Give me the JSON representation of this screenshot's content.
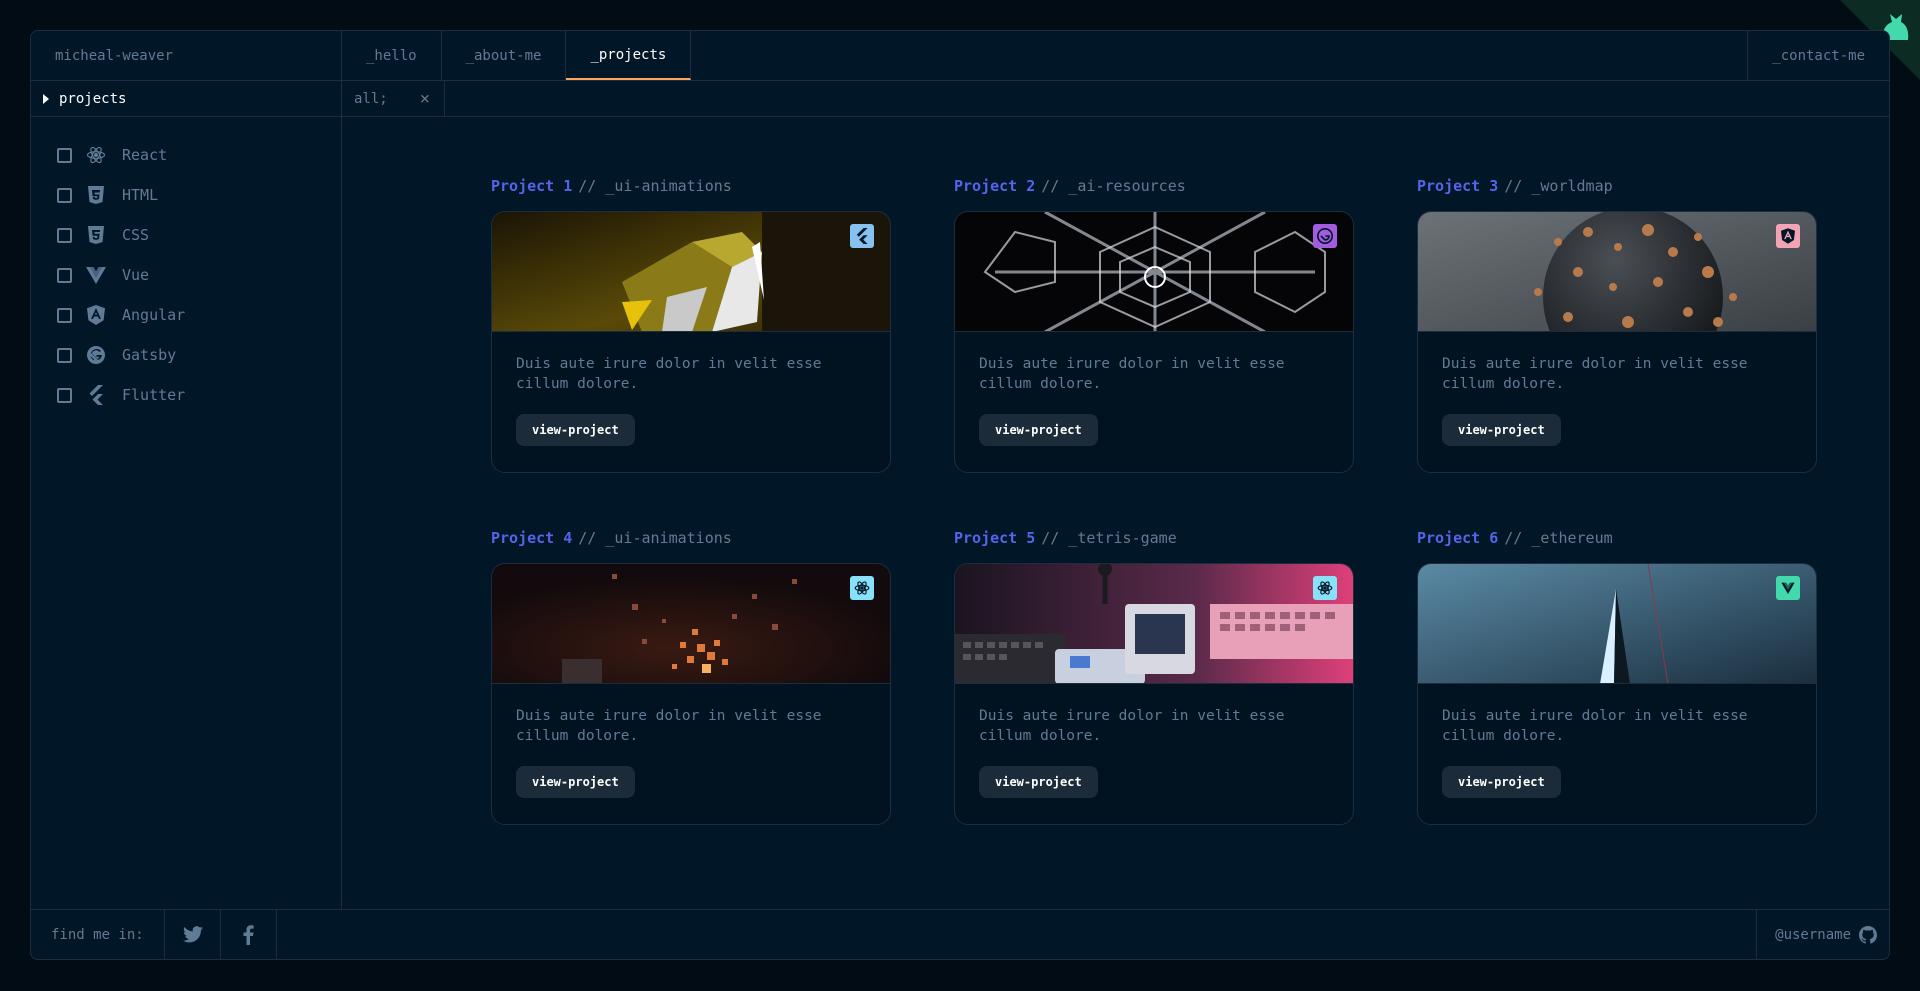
{
  "topbar": {
    "brand": "micheal-weaver",
    "tabs": [
      {
        "label": "_hello"
      },
      {
        "label": "_about-me"
      },
      {
        "label": "_projects"
      }
    ],
    "contact": "_contact-me"
  },
  "sidebar": {
    "header": "projects",
    "filters": [
      {
        "label": "React",
        "icon": "react-icon"
      },
      {
        "label": "HTML",
        "icon": "html5-icon"
      },
      {
        "label": "CSS",
        "icon": "css3-icon"
      },
      {
        "label": "Vue",
        "icon": "vue-icon"
      },
      {
        "label": "Angular",
        "icon": "angular-icon"
      },
      {
        "label": "Gatsby",
        "icon": "gatsby-icon"
      },
      {
        "label": "Flutter",
        "icon": "flutter-icon"
      }
    ]
  },
  "filterbar": {
    "tab_label": "all;",
    "close": "×"
  },
  "projects": [
    {
      "num": "Project 1",
      "sub": "// _ui-animations",
      "desc": "Duis aute irure dolor in velit esse cillum dolore.",
      "button": "view-project",
      "tech_icon": "flutter-icon",
      "badge_color": "#86e1f9"
    },
    {
      "num": "Project 2",
      "sub": "// _ai-resources",
      "desc": "Duis aute irure dolor in velit esse cillum dolore.",
      "button": "view-project",
      "tech_icon": "gatsby-icon",
      "badge_color": "#c98bdf"
    },
    {
      "num": "Project 3",
      "sub": "// _worldmap",
      "desc": "Duis aute irure dolor in velit esse cillum dolore.",
      "button": "view-project",
      "tech_icon": "angular-icon",
      "badge_color": "#e99287"
    },
    {
      "num": "Project 4",
      "sub": "// _ui-animations",
      "desc": "Duis aute irure dolor in velit esse cillum dolore.",
      "button": "view-project",
      "tech_icon": "react-icon",
      "badge_color": "#86e1f9"
    },
    {
      "num": "Project 5",
      "sub": "// _tetris-game",
      "desc": "Duis aute irure dolor in velit esse cillum dolore.",
      "button": "view-project",
      "tech_icon": "react-icon",
      "badge_color": "#86e1f9"
    },
    {
      "num": "Project 6",
      "sub": "// _ethereum",
      "desc": "Duis aute irure dolor in velit esse cillum dolore.",
      "button": "view-project",
      "tech_icon": "vue-icon",
      "badge_color": "#43d9ad"
    }
  ],
  "footer": {
    "find_me": "find me in:",
    "social": [
      "twitter-icon",
      "facebook-icon"
    ],
    "username": "@username"
  },
  "colors": {
    "accent": "#fea55f",
    "project_title": "#5565e8",
    "text": "#607b96",
    "border": "#1e2d3d",
    "background": "#011627"
  }
}
